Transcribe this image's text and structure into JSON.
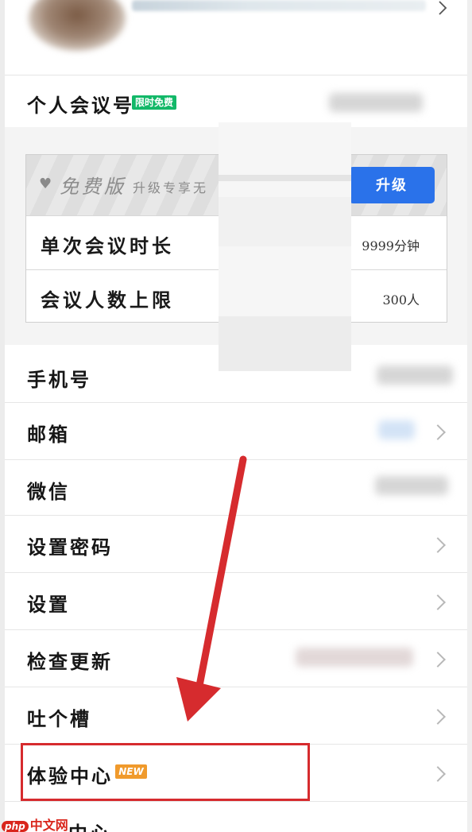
{
  "meeting_id": {
    "label": "个人会议号",
    "badge": "限时免费"
  },
  "plan": {
    "name": "免费版",
    "subtitle": "升级专享无",
    "upgrade_label": "升级",
    "rows": [
      {
        "label": "单次会议时长",
        "value": "9999分钟"
      },
      {
        "label": "会议人数上限",
        "value": "300人"
      }
    ]
  },
  "menu": {
    "phone": "手机号",
    "email": "邮箱",
    "wechat": "微信",
    "set_password": "设置密码",
    "settings": "设置",
    "check_update": "检查更新",
    "feedback": "吐个槽",
    "experience_center": "体验中心",
    "experience_badge": "NEW",
    "partial_next": "中心"
  },
  "watermark": {
    "prefix": "php",
    "text": "中文网"
  },
  "colors": {
    "upgrade_button": "#2a72ea",
    "free_badge": "#12b868",
    "new_badge": "#f09a2c",
    "annotation_red": "#d62b2e"
  }
}
